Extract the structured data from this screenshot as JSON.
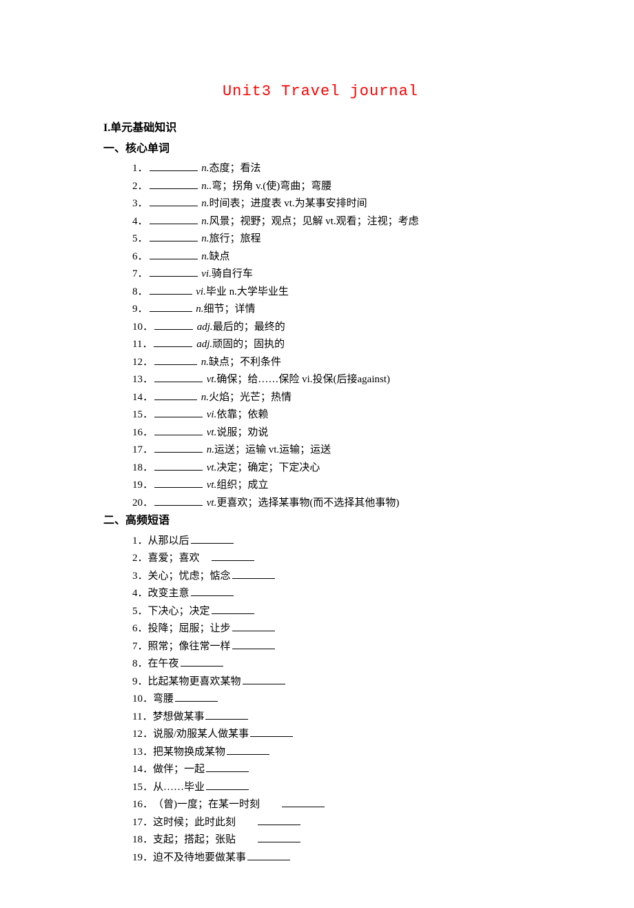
{
  "title": "Unit3 Travel journal",
  "sectionI": "I.单元基础知识",
  "section1": "一、核心单词",
  "vocab": [
    {
      "n": "1．",
      "pos": "n.",
      "def": "态度；看法"
    },
    {
      "n": "2．",
      "pos": "n..",
      "def": "弯；拐角  v.(使)弯曲；弯腰"
    },
    {
      "n": "3．",
      "pos": "n.",
      "def": "时间表；进度表  vt.为某事安排时间"
    },
    {
      "n": "4．",
      "pos": "n.",
      "def": "风景；视野；观点；见解  vt.观看；注视；考虑"
    },
    {
      "n": "5．",
      "pos": "n.",
      "def": "旅行；旅程"
    },
    {
      "n": "6．",
      "pos": "n.",
      "def": "缺点"
    },
    {
      "n": "7．",
      "pos": "vi.",
      "def": "骑自行车"
    },
    {
      "n": "8．",
      "pos": "vi.",
      "def": "毕业  n.大学毕业生"
    },
    {
      "n": "9．",
      "pos": "n.",
      "def": "细节；详情"
    },
    {
      "n": "10．",
      "pos": "adj.",
      "def": "最后的；最终的"
    },
    {
      "n": "11．",
      "pos": "adj.",
      "def": "顽固的；固执的"
    },
    {
      "n": "12．",
      "pos": "n.",
      "def": "缺点；不利条件"
    },
    {
      "n": "13．",
      "pos": "vt.",
      "def": "确保；给……保险  vi.投保(后接against)"
    },
    {
      "n": "14．",
      "pos": "n.",
      "def": "火焰；光芒；热情"
    },
    {
      "n": "15．",
      "pos": "vi.",
      "def": "依靠；依赖"
    },
    {
      "n": "16．",
      "pos": "vt.",
      "def": "说服；劝说"
    },
    {
      "n": "17．",
      "pos": "n.",
      "def": "运送；运输  vt.运输；运送"
    },
    {
      "n": "18．",
      "pos": "vt.",
      "def": "决定；确定；下定决心"
    },
    {
      "n": "19．",
      "pos": "vt.",
      "def": "组织；成立"
    },
    {
      "n": "20．",
      "pos": "vt.",
      "def": "更喜欢；选择某事物(而不选择其他事物)"
    }
  ],
  "section2": "二、高频短语",
  "phrases": [
    {
      "n": "1．",
      "t": "从那以后"
    },
    {
      "n": "2．",
      "t": "喜爱；喜欢　"
    },
    {
      "n": "3．",
      "t": "关心；忧虑；惦念"
    },
    {
      "n": "4．",
      "t": "改变主意"
    },
    {
      "n": "5．",
      "t": "下决心；决定"
    },
    {
      "n": "6．",
      "t": "投降；屈服；让步"
    },
    {
      "n": "7．",
      "t": "照常；像往常一样"
    },
    {
      "n": "8．",
      "t": "在午夜"
    },
    {
      "n": "9．",
      "t": "比起某物更喜欢某物"
    },
    {
      "n": "10．",
      "t": "弯腰"
    },
    {
      "n": "11．",
      "t": "梦想做某事"
    },
    {
      "n": "12．",
      "t": "说服/劝服某人做某事"
    },
    {
      "n": "13．",
      "t": "把某物换成某物"
    },
    {
      "n": "14．",
      "t": "做伴；一起"
    },
    {
      "n": "15．",
      "t": "从……毕业"
    },
    {
      "n": "16．",
      "t": "（曾)一度；在某一时刻　　"
    },
    {
      "n": "17．",
      "t": "这时候；此时此刻　　"
    },
    {
      "n": "18．",
      "t": "支起；搭起；张贴　　"
    },
    {
      "n": "19．",
      "t": "迫不及待地要做某事"
    }
  ]
}
